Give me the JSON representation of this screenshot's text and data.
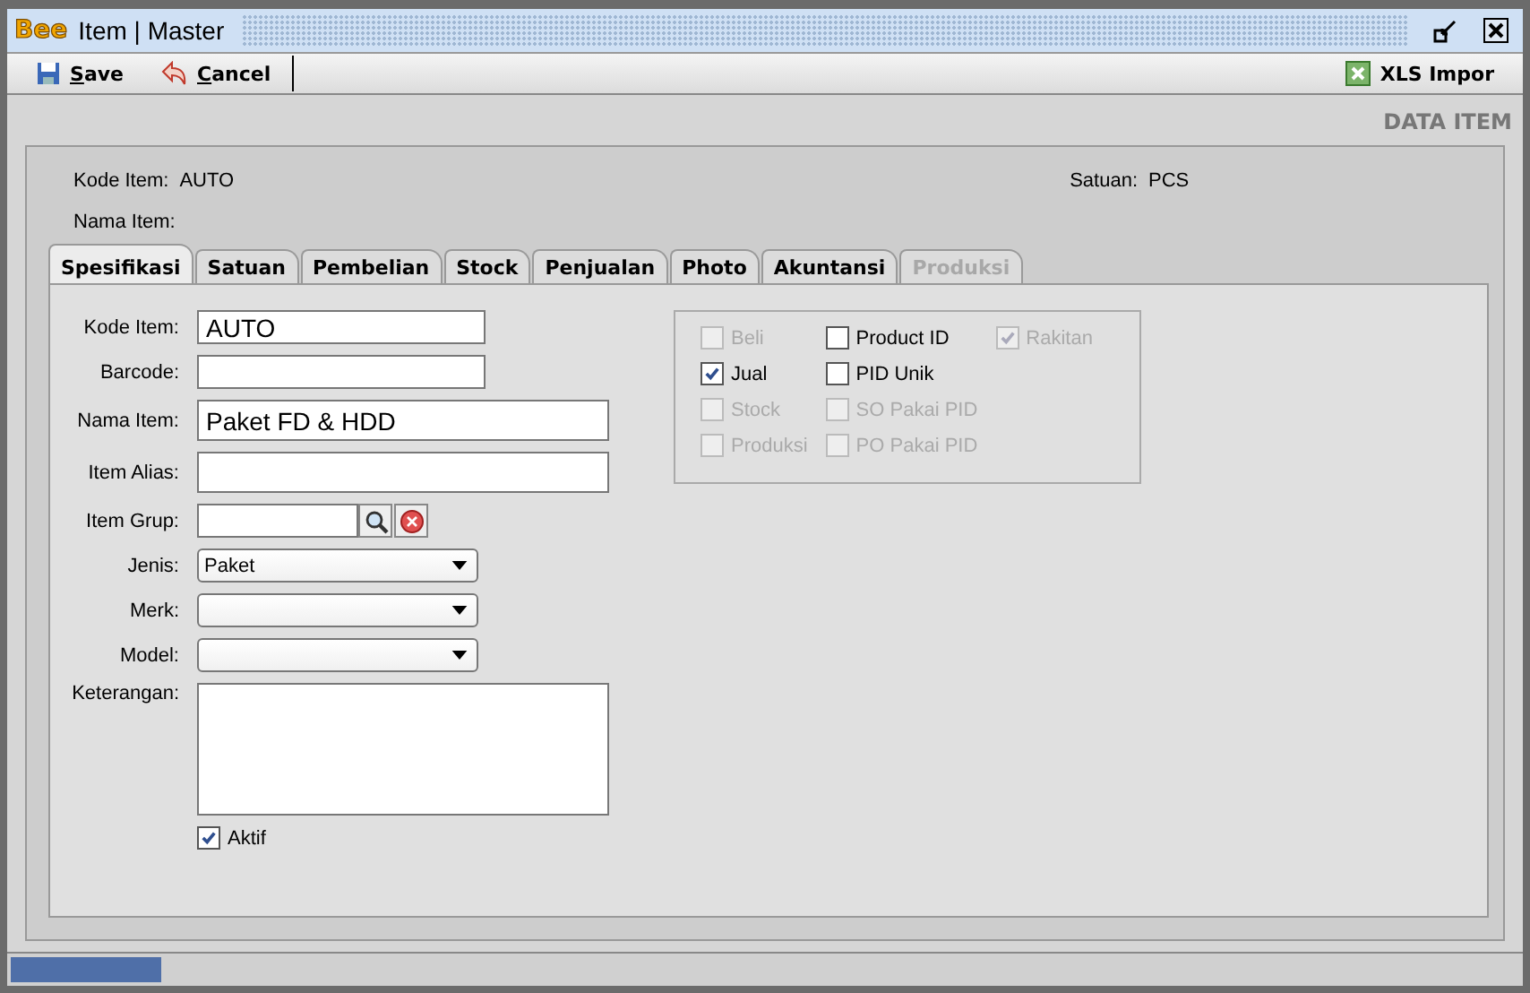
{
  "window": {
    "logo": "Bee",
    "title": "Item | Master"
  },
  "toolbar": [
    {
      "label": "Save",
      "kind": "save"
    },
    {
      "label": "Cancel",
      "kind": "cancel"
    }
  ],
  "xls_button": {
    "label": "XLS Impor",
    "kind": "excel"
  },
  "section_title": "DATA ITEM",
  "header": {
    "kode_label": "Kode Item:",
    "kode_value": "AUTO",
    "nama_label": "Nama Item:",
    "satuan_label": "Satuan:",
    "satuan_value": "PCS"
  },
  "tabs": [
    {
      "label": "Spesifikasi",
      "selected": true,
      "disabled": false
    },
    {
      "label": "Satuan",
      "selected": false,
      "disabled": false
    },
    {
      "label": "Pembelian",
      "selected": false,
      "disabled": false
    },
    {
      "label": "Stock",
      "selected": false,
      "disabled": false
    },
    {
      "label": "Penjualan",
      "selected": false,
      "disabled": false
    },
    {
      "label": "Photo",
      "selected": false,
      "disabled": false
    },
    {
      "label": "Akuntansi",
      "selected": false,
      "disabled": false
    },
    {
      "label": "Produksi",
      "selected": false,
      "disabled": true
    }
  ],
  "form": [
    {
      "label": "Kode Item:",
      "kind": "field",
      "value": "AUTO"
    },
    {
      "label": "Barcode:",
      "kind": "field"
    },
    {
      "label": "Nama Item:",
      "kind": "widefield",
      "value": "Paket FD & HDD"
    },
    {
      "label": "Item Alias:",
      "kind": "widefield"
    },
    {
      "label": "Item Grup:",
      "kind": "lookup"
    },
    {
      "label": "Jenis:",
      "kind": "select",
      "value": "Paket"
    },
    {
      "label": "Merk:",
      "kind": "select"
    },
    {
      "label": "Model:",
      "kind": "select"
    },
    {
      "label": "Keterangan:",
      "kind": "memo"
    }
  ],
  "aktif": {
    "label": "Aktif",
    "checked": true
  },
  "options": [
    [
      {
        "label": "Beli",
        "checked": false,
        "disabled": true
      },
      {
        "label": "Jual",
        "checked": true,
        "disabled": false
      },
      {
        "label": "Stock",
        "checked": false,
        "disabled": true
      },
      {
        "label": "Produksi",
        "checked": false,
        "disabled": true
      }
    ],
    [
      {
        "label": "Product ID",
        "checked": false,
        "disabled": false
      },
      {
        "label": "PID Unik",
        "checked": false,
        "disabled": false
      },
      {
        "label": "SO Pakai PID",
        "checked": false,
        "disabled": true
      },
      {
        "label": "PO Pakai PID",
        "checked": false,
        "disabled": true
      }
    ],
    [
      {
        "label": "Rakitan",
        "checked": true,
        "disabled": true
      }
    ]
  ],
  "status_bar": {
    "progress": {
      "level": 0.1
    }
  }
}
